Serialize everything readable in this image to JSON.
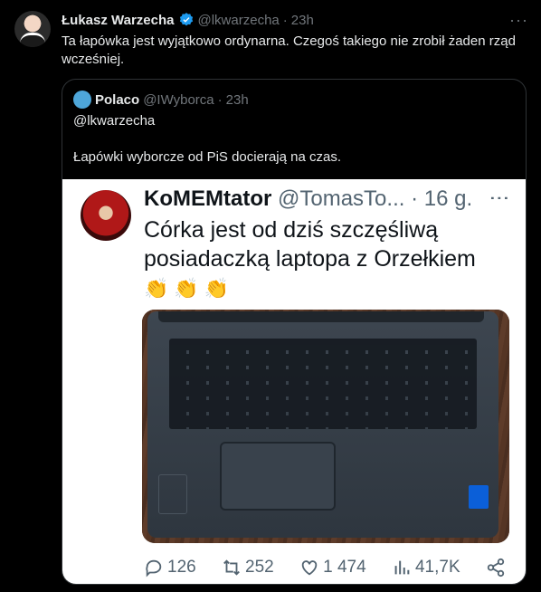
{
  "tweet": {
    "author_name": "Łukasz Warzecha",
    "handle": "@lkwarzecha",
    "separator": "·",
    "time": "23h",
    "more_label": "···",
    "text": "Ta łapówka jest wyjątkowo ordynarna. Czegoś takiego nie zrobił żaden rząd wcześniej."
  },
  "quote": {
    "author_name": "Polaco",
    "handle": "@IWyborca",
    "separator": "·",
    "time": "23h",
    "line1": "@lkwarzecha",
    "line2": "Łapówki wyborcze od PiS  docierają na czas."
  },
  "screenshot": {
    "author_name": "KoMEMtator",
    "handle": "@TomasTo...",
    "separator": "·",
    "time": "16 g.",
    "more_label": "⋮",
    "text": "Córka jest od dziś szczęśliwą posiadaczką laptopa z Orzełkiem",
    "emoji": [
      "👏",
      "👏",
      "👏"
    ],
    "actions": {
      "replies": "126",
      "reposts": "252",
      "likes": "1 474",
      "views": "41,7K"
    }
  },
  "colors": {
    "background": "#000000",
    "text_primary": "#e7e9ea",
    "text_secondary": "#71767b",
    "verified_blue": "#1d9bf0",
    "border": "#2f3336"
  }
}
